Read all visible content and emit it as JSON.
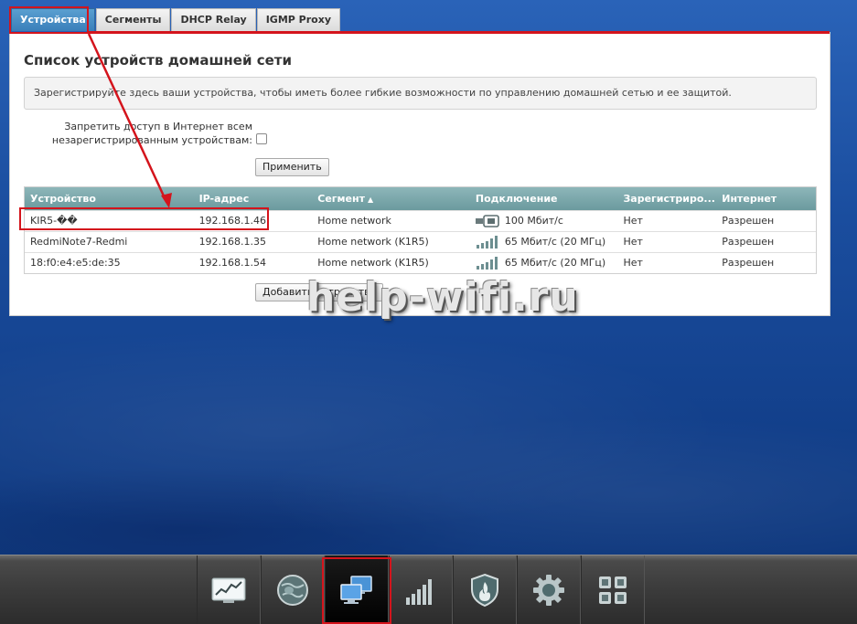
{
  "tabs": [
    {
      "label": "Устройства",
      "active": true
    },
    {
      "label": "Сегменты",
      "active": false
    },
    {
      "label": "DHCP Relay",
      "active": false
    },
    {
      "label": "IGMP Proxy",
      "active": false
    }
  ],
  "page": {
    "title": "Список устройств домашней сети",
    "info": "Зарегистрируйте здесь ваши устройства, чтобы иметь более гибкие возможности по управлению домашней сетью и ее защитой.",
    "block_option_line1": "Запретить доступ в Интернет всем",
    "block_option_line2": "незарегистрированным устройствам:",
    "apply_label": "Применить",
    "add_device_label": "Добавить устройство"
  },
  "table": {
    "columns": [
      "Устройство",
      "IP-адрес",
      "Сегмент",
      "Подключение",
      "Зарегистриро...",
      "Интернет"
    ],
    "sort_indicator": "▲",
    "rows": [
      {
        "device": "KIR5-��",
        "ip": "192.168.1.46",
        "segment": "Home network",
        "connection": "100 Мбит/с",
        "conn_icon": "ethernet-port-icon",
        "registered": "Нет",
        "internet": "Разрешен"
      },
      {
        "device": "RedmiNote7-Redmi",
        "ip": "192.168.1.35",
        "segment": "Home network (K1R5)",
        "connection": "65 Мбит/с (20 МГц)",
        "conn_icon": "wifi-signal-icon",
        "registered": "Нет",
        "internet": "Разрешен"
      },
      {
        "device": "18:f0:e4:e5:de:35",
        "ip": "192.168.1.54",
        "segment": "Home network (K1R5)",
        "connection": "65 Мбит/с (20 МГц)",
        "conn_icon": "wifi-signal-icon",
        "registered": "Нет",
        "internet": "Разрешен"
      }
    ]
  },
  "watermark": "help-wifi.ru",
  "dock": [
    {
      "icon": "monitor-chart-icon",
      "active": false
    },
    {
      "icon": "globe-icon",
      "active": false
    },
    {
      "icon": "home-network-icon",
      "active": true
    },
    {
      "icon": "signal-bars-icon",
      "active": false
    },
    {
      "icon": "shield-icon",
      "active": false
    },
    {
      "icon": "gear-icon",
      "active": false
    },
    {
      "icon": "apps-grid-icon",
      "active": false
    }
  ],
  "colors": {
    "highlight": "#d4141c",
    "tab_active": "#3a7fba",
    "table_header": "#7aa7aa"
  }
}
